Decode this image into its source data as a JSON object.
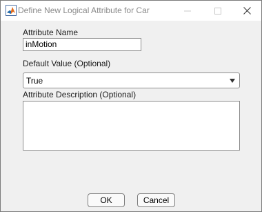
{
  "window": {
    "title": "Define New Logical Attribute for Car"
  },
  "form": {
    "name_label": "Attribute Name",
    "name_value": "inMotion",
    "default_label": "Default Value (Optional)",
    "default_value": "True",
    "description_label": "Attribute Description (Optional)",
    "description_value": ""
  },
  "buttons": {
    "ok_label": "OK",
    "cancel_label": "Cancel"
  },
  "icons": {
    "app": "matlab-logo-icon",
    "minimize": "minimize-icon",
    "maximize": "maximize-icon",
    "close": "close-icon",
    "dropdown": "chevron-down-icon"
  },
  "colors": {
    "title_text": "#8a8a8a",
    "window_bg": "#f0f0f0",
    "logo_orange": "#e16a1c",
    "logo_blue": "#1f6fb5"
  }
}
